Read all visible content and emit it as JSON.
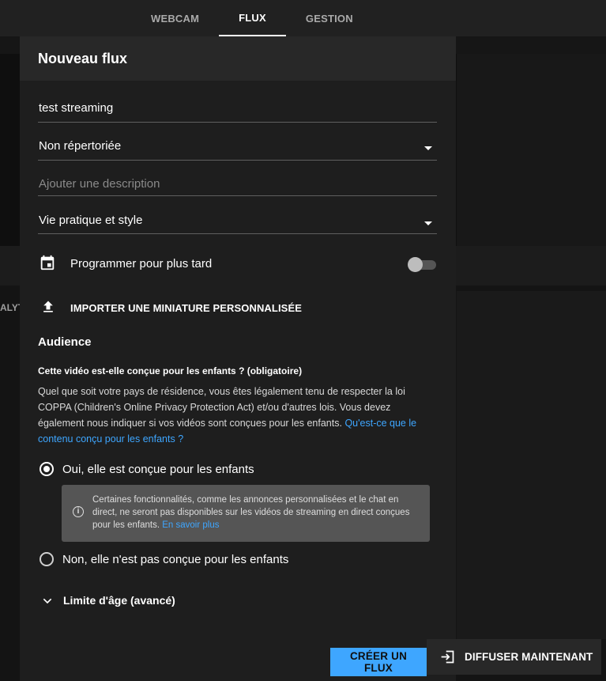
{
  "tabs": [
    {
      "label": "WEBCAM"
    },
    {
      "label": "FLUX"
    },
    {
      "label": "GESTION"
    }
  ],
  "background": {
    "left_label": "ALYT"
  },
  "dialog": {
    "title": "Nouveau flux",
    "title_field": {
      "value": "test streaming"
    },
    "visibility_select": {
      "value": "Non répertoriée"
    },
    "description_field": {
      "placeholder": "Ajouter une description"
    },
    "category_select": {
      "value": "Vie pratique et style"
    },
    "schedule": {
      "label": "Programmer pour plus tard",
      "enabled": false
    },
    "upload_thumbnail": {
      "label": "IMPORTER UNE MINIATURE PERSONNALISÉE"
    },
    "audience": {
      "title": "Audience",
      "question": "Cette vidéo est-elle conçue pour les enfants ? (obligatoire)",
      "explanation": "Quel que soit votre pays de résidence, vous êtes légalement tenu de respecter la loi COPPA (Children's Online Privacy Protection Act) et/ou d'autres lois. Vous devez également nous indiquer si vos vidéos sont conçues pour les enfants.",
      "explanation_link": "Qu'est-ce que le contenu conçu pour les enfants ?",
      "option_yes": {
        "label": "Oui, elle est conçue pour les enfants",
        "selected": true
      },
      "info": {
        "text": "Certaines fonctionnalités, comme les annonces personnalisées et le chat en direct, ne seront pas disponibles sur les vidéos de streaming en direct conçues pour les enfants.",
        "link": "En savoir plus"
      },
      "option_no": {
        "label": "Non, elle n'est pas conçue pour les enfants",
        "selected": false
      }
    },
    "age_limit": {
      "label": "Limite d'âge (avancé)"
    },
    "create_button": "CRÉER UN FLUX"
  },
  "float_panel": {
    "button_label": "DIFFUSER MAINTENANT"
  },
  "colors": {
    "accent": "#3ea6ff",
    "dialog_bg": "#1e1e1e",
    "header_bg": "#282828",
    "page_bg": "#0f0f0f"
  }
}
